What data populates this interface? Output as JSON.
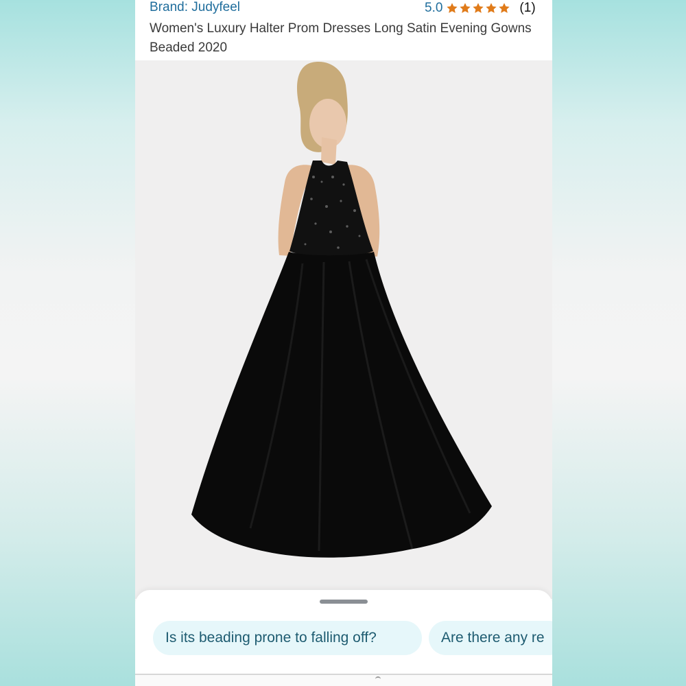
{
  "product": {
    "brand": "Brand: Judyfeel",
    "rating_value": "5.0",
    "star_count": 5,
    "review_count": "(1)",
    "title": "Women's Luxury Halter Prom Dresses Long Satin Evening Gowns Beaded 2020"
  },
  "questions": {
    "chip_1": "Is its beading prone to falling off?",
    "chip_2": "Are there any re"
  },
  "colors": {
    "brand_link": "#1f6d9c",
    "star": "#e07b1a",
    "chip_bg": "#e6f7fa",
    "chip_text": "#1d5b70"
  },
  "icons": {
    "star": "star-icon",
    "handle": "drag-handle-icon"
  }
}
